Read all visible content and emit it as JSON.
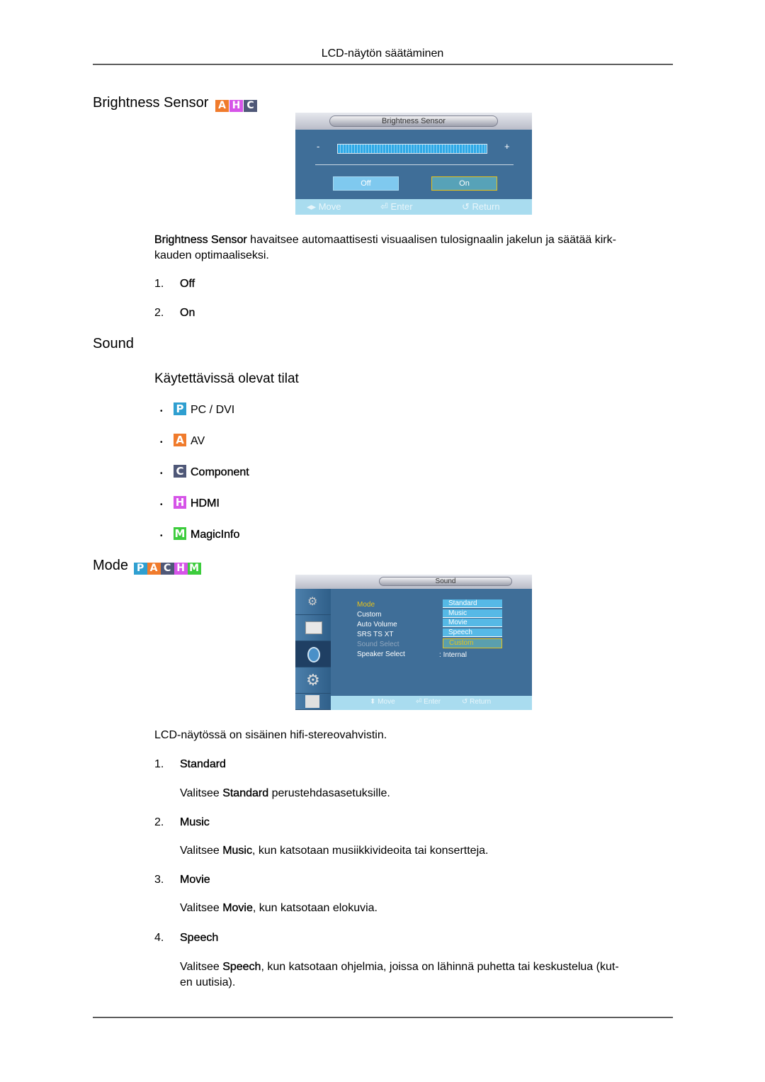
{
  "header": {
    "title": "LCD-näytön säätäminen"
  },
  "colors": {
    "badge_P": "#2f9fd0",
    "badge_A": "#f07b2c",
    "badge_C": "#4f5878",
    "badge_H": "#d654e8",
    "badge_M": "#3ccc3c",
    "osd_bg": "#3f6e98",
    "osd_highlight": "#e8c31a"
  },
  "brightness_sensor": {
    "heading": "Brightness Sensor",
    "badges": [
      {
        "letter": "A",
        "icon": "av-badge-icon"
      },
      {
        "letter": "H",
        "icon": "hdmi-badge-icon"
      },
      {
        "letter": "C",
        "icon": "component-badge-icon"
      }
    ],
    "osd": {
      "title": "Brightness Sensor",
      "minus": "-",
      "plus": "+",
      "off_label": "Off",
      "on_label": "On",
      "selected": "On",
      "footer": {
        "move": "Move",
        "enter": "Enter",
        "return": "Return"
      }
    },
    "description_bold": "Brightness Sensor",
    "description_line1": " havaitsee automaattisesti visuaalisen tulosignaalin jakelun ja säätää kirk-",
    "description_line2": "kauden optimaaliseksi.",
    "options": [
      {
        "num": "1.",
        "label": "Off"
      },
      {
        "num": "2.",
        "label": "On"
      }
    ]
  },
  "sound": {
    "heading": "Sound",
    "subheading": "Käytettävissä olevat tilat",
    "modes": [
      {
        "letter": "P",
        "label": "PC / DVI",
        "icon": "pc-dvi-badge-icon"
      },
      {
        "letter": "A",
        "label": "AV",
        "icon": "av-badge-icon"
      },
      {
        "letter": "C",
        "label": "Component",
        "icon": "component-badge-icon"
      },
      {
        "letter": "H",
        "label": "HDMI",
        "icon": "hdmi-badge-icon"
      },
      {
        "letter": "M",
        "label": "MagicInfo",
        "icon": "magicinfo-badge-icon"
      }
    ]
  },
  "mode": {
    "heading": "Mode",
    "badges": [
      "P",
      "A",
      "C",
      "H",
      "M"
    ],
    "osd": {
      "title": "Sound",
      "menu": [
        {
          "label": "Mode",
          "state": "active"
        },
        {
          "label": "Custom",
          "state": "normal"
        },
        {
          "label": "Auto Volume",
          "state": "normal"
        },
        {
          "label": "SRS TS XT",
          "state": "normal"
        },
        {
          "label": "Sound Select",
          "state": "disabled"
        },
        {
          "label": "Speaker Select",
          "state": "normal",
          "value": "Internal"
        }
      ],
      "dropdown": [
        "Standard",
        "Music",
        "Movie",
        "Speech",
        "Custom"
      ],
      "dropdown_selected": "Custom",
      "sidebar_icons": [
        "input-icon",
        "picture-icon",
        "sound-icon",
        "setup-icon",
        "multi-control-icon"
      ],
      "footer": {
        "move": "Move",
        "enter": "Enter",
        "return": "Return"
      }
    },
    "intro": "LCD-näytössä on sisäinen hifi-stereovahvistin.",
    "items": [
      {
        "num": "1.",
        "label": "Standard",
        "pre": "Valitsee ",
        "bold": "Standard",
        "post": " perustehdasasetuksille."
      },
      {
        "num": "2.",
        "label": "Music",
        "pre": "Valitsee ",
        "bold": "Music",
        "post": ", kun katsotaan musiikkivideoita tai konsertteja."
      },
      {
        "num": "3.",
        "label": "Movie",
        "pre": "Valitsee ",
        "bold": "Movie",
        "post": ", kun katsotaan elokuvia."
      },
      {
        "num": "4.",
        "label": "Speech",
        "pre": "Valitsee ",
        "bold": "Speech",
        "post": ", kun katsotaan ohjelmia, joissa on lähinnä puhetta tai keskustelua (kut-",
        "post2": "en uutisia)."
      }
    ]
  }
}
